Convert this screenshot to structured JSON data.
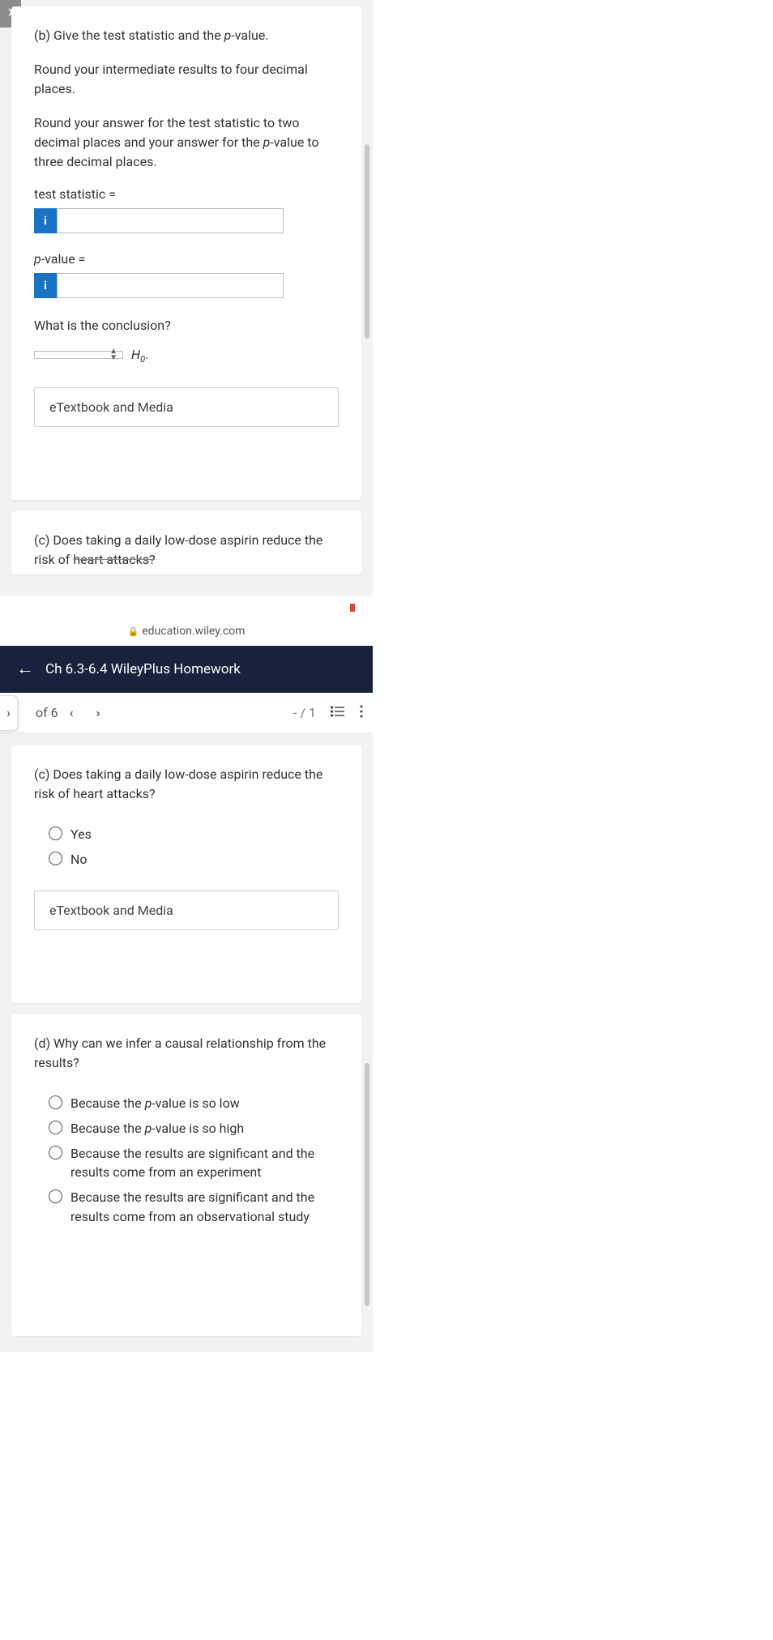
{
  "screen1": {
    "partB": {
      "prompt": "(b) Give the test statistic and the p-value.",
      "instr1": "Round your intermediate results to four decimal places.",
      "instr2": "Round your answer for the test statistic to two decimal places and your answer for the p-value to three decimal places.",
      "testStatLabel": "test statistic  =",
      "pvalLabelPre": "p",
      "pvalLabelPost": "-value  =",
      "conclusionQ": "What is the conclusion?",
      "h0_H": "H",
      "h0_sub": "0",
      "h0_dot": ".",
      "etextbook": "eTextbook and Media"
    },
    "partC_cut": {
      "text_pre": "(c) Does taking a daily low-dose aspirin reduce the risk of ",
      "text_strike": "heart attacks?"
    }
  },
  "screen2": {
    "status": {
      "time": ""
    },
    "url": "education.wiley.com",
    "header": "Ch 6.3-6.4 WileyPlus Homework",
    "nav": {
      "ofn": "of 6",
      "score": "- / 1"
    },
    "partC": {
      "prompt": "(c) Does taking a daily low-dose aspirin reduce the risk of heart attacks?",
      "opt_yes": "Yes",
      "opt_no": "No",
      "etextbook": "eTextbook and Media"
    },
    "partD": {
      "prompt": "(d) Why can we infer a causal relationship from the results?",
      "opt1_pre": "Because the ",
      "opt1_p": "p",
      "opt1_post": "-value is so low",
      "opt2_pre": "Because the ",
      "opt2_p": "p",
      "opt2_post": "-value is so high",
      "opt3": "Because the results are significant and the results come from an experiment",
      "opt4": "Because the results are significant and the results come from an observational study"
    }
  }
}
